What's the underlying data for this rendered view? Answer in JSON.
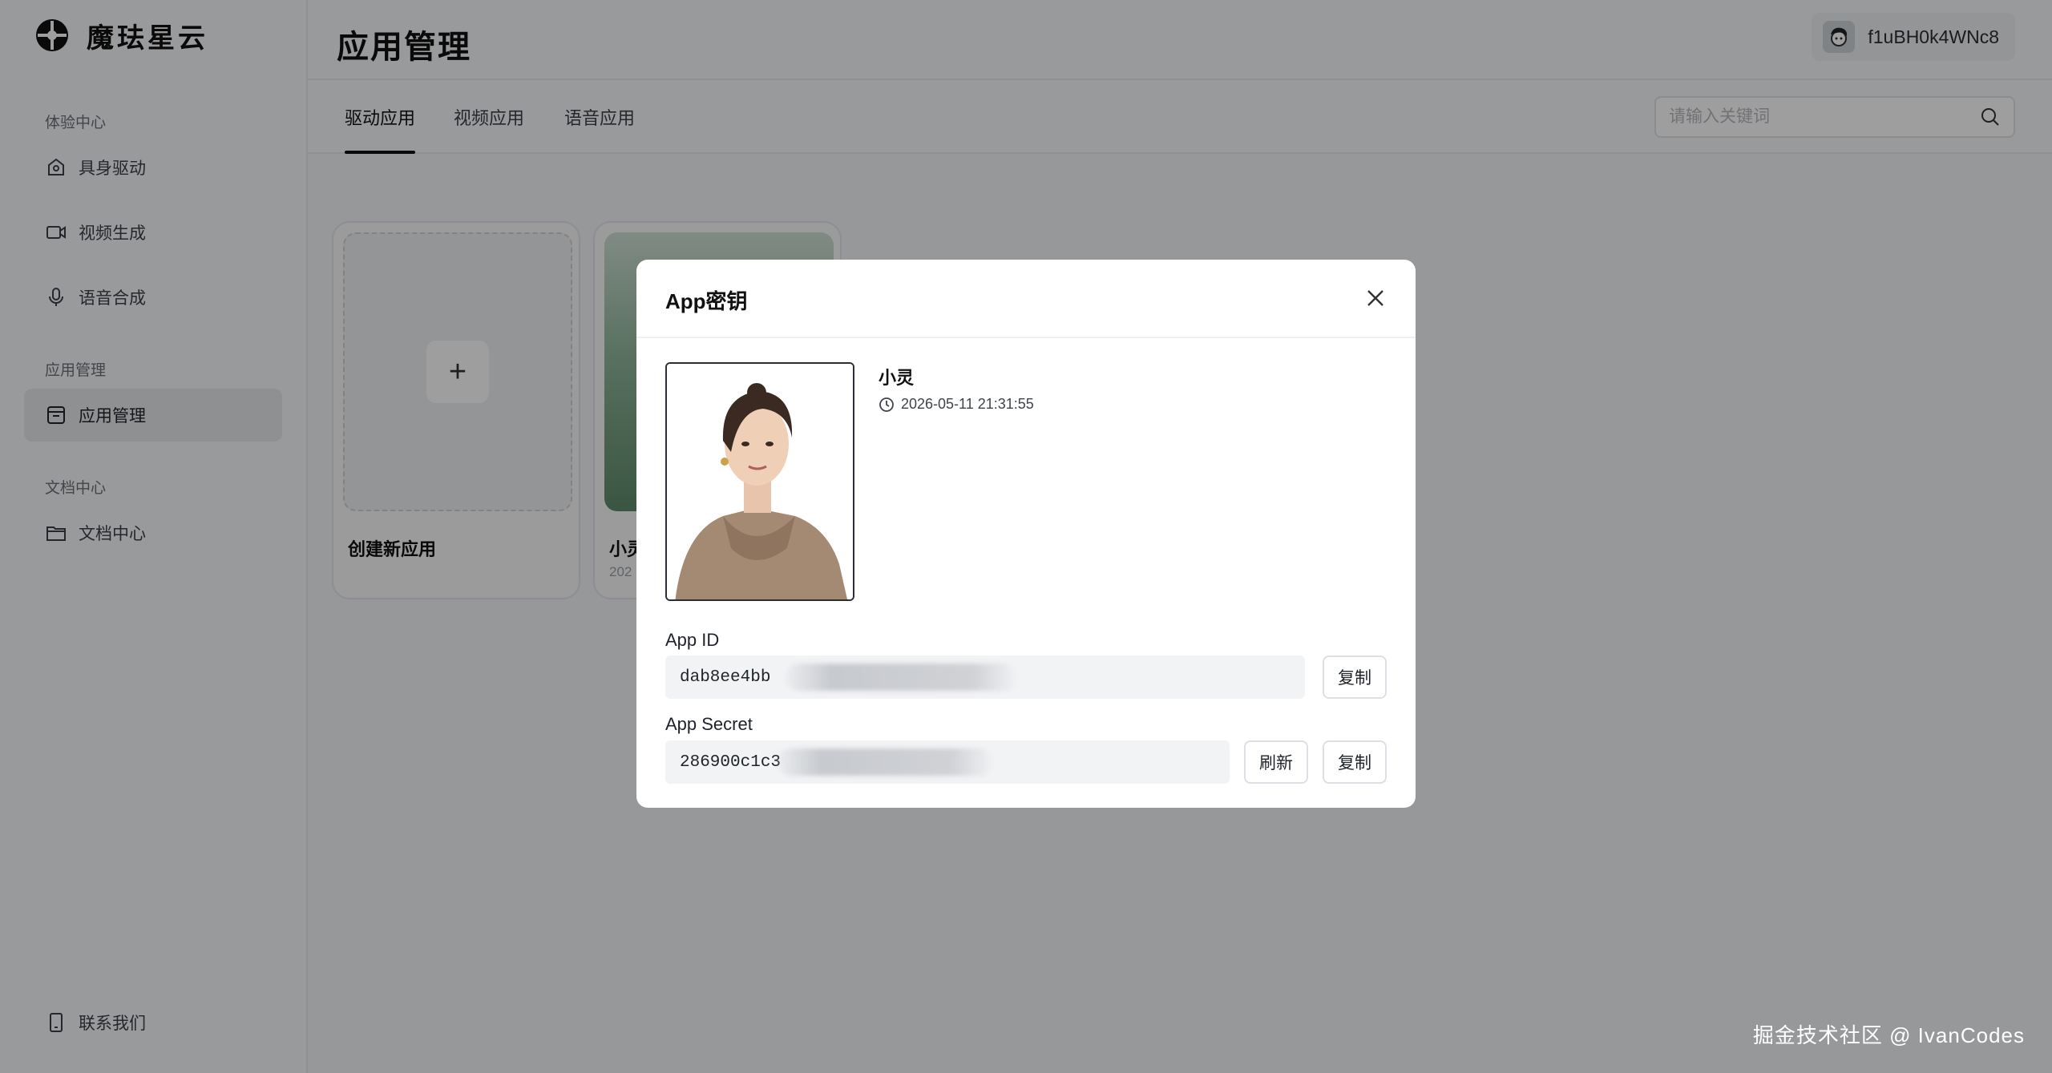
{
  "brand": {
    "name": "魔珐星云"
  },
  "sidebar": {
    "sections": [
      {
        "label": "体验中心"
      },
      {
        "label": "应用管理"
      },
      {
        "label": "文档中心"
      }
    ],
    "items": [
      {
        "label": "具身驱动",
        "icon": "home-camera-icon"
      },
      {
        "label": "视频生成",
        "icon": "video-icon"
      },
      {
        "label": "语音合成",
        "icon": "microphone-icon"
      },
      {
        "label": "应用管理",
        "icon": "app-box-icon"
      },
      {
        "label": "文档中心",
        "icon": "folder-icon"
      }
    ],
    "footer": {
      "label": "联系我们",
      "icon": "phone-icon"
    }
  },
  "header": {
    "title": "应用管理",
    "user": {
      "name": "f1uBH0k4WNc8"
    }
  },
  "tabs": [
    {
      "label": "驱动应用"
    },
    {
      "label": "视频应用"
    },
    {
      "label": "语音应用"
    }
  ],
  "search": {
    "placeholder": "请输入关键词"
  },
  "cards": {
    "create": {
      "label": "创建新应用",
      "plus": "+"
    },
    "app": {
      "title": "小灵",
      "date_fragment": "202"
    }
  },
  "modal": {
    "title": "App密钥",
    "app_name": "小灵",
    "created_at": "2026-05-11 21:31:55",
    "app_id": {
      "label": "App ID",
      "value": "dab8ee4bb",
      "copy_label": "复制"
    },
    "app_secret": {
      "label": "App Secret",
      "value": "286900c1c3",
      "refresh_label": "刷新",
      "copy_label": "复制"
    }
  },
  "watermark": "掘金技术社区 @ IvanCodes",
  "colors": {
    "overlay": "#000000",
    "accent": "#111111"
  }
}
